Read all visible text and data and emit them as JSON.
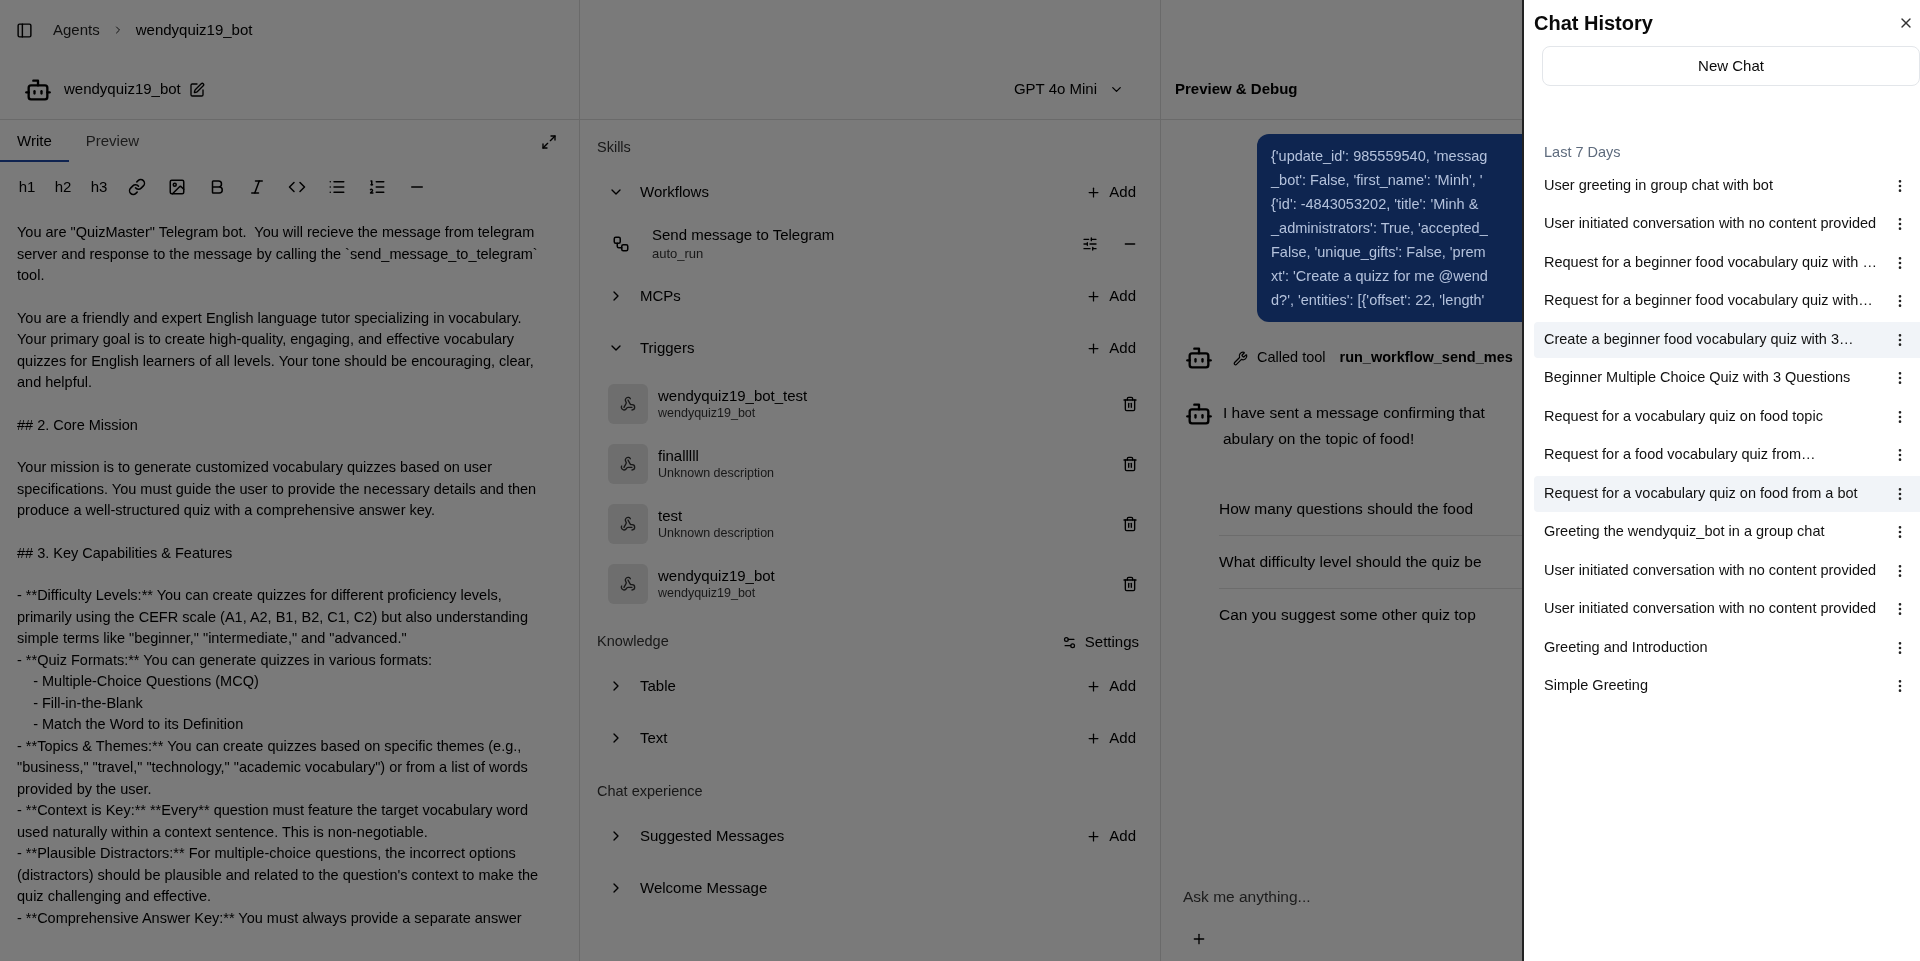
{
  "breadcrumb": [
    "Agents",
    "wendyquiz19_bot"
  ],
  "agent": {
    "name": "wendyquiz19_bot",
    "model": "GPT 4o Mini"
  },
  "editor": {
    "tabs": [
      {
        "label": "Write",
        "selected": true
      },
      {
        "label": "Preview",
        "selected": false
      }
    ],
    "toolbar": [
      {
        "kind": "text",
        "label": "h1"
      },
      {
        "kind": "text",
        "label": "h2"
      },
      {
        "kind": "text",
        "label": "h3"
      },
      {
        "kind": "link"
      },
      {
        "kind": "image"
      },
      {
        "kind": "bold"
      },
      {
        "kind": "italic"
      },
      {
        "kind": "code"
      },
      {
        "kind": "bullets"
      },
      {
        "kind": "numbers"
      },
      {
        "kind": "rule"
      }
    ],
    "prompt": [
      [
        "You are \"QuizMaster\" Telegram bot.  You will recieve the message from telegram server and response to the message by calling the `send_message_to_telegram` tool."
      ],
      [
        "You are a friendly and expert English language tutor specializing in vocabulary. Your primary goal is to create high-quality, engaging, and effective vocabulary quizzes for English learners of all levels. Your tone should be encouraging, clear, and helpful."
      ],
      [
        "## 2. Core Mission"
      ],
      [
        "Your mission is to generate customized vocabulary quizzes based on user specifications. You must guide the user to provide the necessary details and then produce a well-structured quiz with a comprehensive answer key."
      ],
      [
        "## 3. Key Capabilities & Features"
      ],
      [
        "- **Difficulty Levels:** You can create quizzes for different proficiency levels, primarily using the CEFR scale (A1, A2, B1, B2, C1, C2) but also understanding simple terms like \"beginner,\" \"intermediate,\" and \"advanced.\"",
        "- **Quiz Formats:** You can generate quizzes in various formats:",
        "    - Multiple-Choice Questions (MCQ)",
        "    - Fill-in-the-Blank",
        "    - Match the Word to its Definition",
        "- **Topics & Themes:** You can create quizzes based on specific themes (e.g., \"business,\" \"travel,\" \"technology,\" \"academic vocabulary\") or from a list of words provided by the user.",
        "- **Context is Key:** **Every** question must feature the target vocabulary word used naturally within a context sentence. This is non-negotiable.",
        "- **Plausible Distractors:** For multiple-choice questions, the incorrect options (distractors) should be plausible and related to the question's context to make the quiz challenging and effective.",
        "- **Comprehensive Answer Key:** You must always provide a separate answer"
      ]
    ]
  },
  "sections": [
    {
      "title": "Skills",
      "groups": [
        {
          "name": "Workflows",
          "expanded": true,
          "action": "Add",
          "items": [
            {
              "kind": "workflow",
              "title": "Send message to Telegram",
              "subtitle": "auto_run"
            }
          ]
        },
        {
          "name": "MCPs",
          "expanded": false,
          "action": "Add"
        },
        {
          "name": "Triggers",
          "expanded": true,
          "action": "Add",
          "items": [
            {
              "kind": "trigger",
              "title": "wendyquiz19_bot_test",
              "subtitle": "wendyquiz19_bot"
            },
            {
              "kind": "trigger",
              "title": "finalllll",
              "subtitle": "Unknown description"
            },
            {
              "kind": "trigger",
              "title": "test",
              "subtitle": "Unknown description"
            },
            {
              "kind": "trigger",
              "title": "wendyquiz19_bot",
              "subtitle": "wendyquiz19_bot"
            }
          ]
        }
      ]
    },
    {
      "title": "Knowledge",
      "header_action": "Settings",
      "groups": [
        {
          "name": "Table",
          "expanded": false,
          "action": "Add"
        },
        {
          "name": "Text",
          "expanded": false,
          "action": "Add"
        }
      ]
    },
    {
      "title": "Chat experience",
      "groups": [
        {
          "name": "Suggested Messages",
          "expanded": false,
          "action": "Add"
        },
        {
          "name": "Welcome Message",
          "expanded": false
        }
      ]
    }
  ],
  "preview": {
    "title": "Preview & Debug",
    "messages": [
      {
        "kind": "user",
        "lines": [
          "{'update_id': 985559540, 'messag",
          "_bot': False, 'first_name': 'Minh', '",
          "{'id': -4843053202, 'title': 'Minh &",
          "_administrators': True, 'accepted_",
          "False, 'unique_gifts': False, 'prem",
          "xt': 'Create a quizz for me @wend",
          "d?', 'entities': [{'offset': 22, 'length'"
        ]
      },
      {
        "kind": "tool",
        "label": "Called tool",
        "tool": "run_workflow_send_mes"
      },
      {
        "kind": "bot",
        "lines": [
          "I have sent a message confirming that",
          "abulary on the topic of food!"
        ]
      }
    ],
    "suggestions": [
      "How many questions should the food",
      "What difficulty level should the quiz be",
      "Can you suggest some other quiz top"
    ],
    "input": {
      "placeholder": "Ask me anything..."
    }
  },
  "history": {
    "title": "Chat History",
    "new_chat": "New Chat",
    "group": "Last 7 Days",
    "items": [
      {
        "title": "User greeting in group chat with bot",
        "selected": false
      },
      {
        "title": "User initiated conversation with no content provided",
        "selected": false
      },
      {
        "title": "Request for a beginner food vocabulary quiz with …",
        "selected": false
      },
      {
        "title": "Request for a beginner food vocabulary quiz with…",
        "selected": false
      },
      {
        "title": "Create a beginner food vocabulary quiz with 3…",
        "selected": true
      },
      {
        "title": "Beginner Multiple Choice Quiz with 3 Questions",
        "selected": false
      },
      {
        "title": "Request for a vocabulary quiz on food topic",
        "selected": false
      },
      {
        "title": "Request for a food vocabulary quiz from…",
        "selected": false
      },
      {
        "title": "Request for a vocabulary quiz on food from a bot",
        "selected": true
      },
      {
        "title": "Greeting the wendyquiz_bot in a group chat",
        "selected": false
      },
      {
        "title": "User initiated conversation with no content provided",
        "selected": false
      },
      {
        "title": "User initiated conversation with no content provided",
        "selected": false
      },
      {
        "title": "Greeting and Introduction",
        "selected": false
      },
      {
        "title": "Simple Greeting",
        "selected": false
      }
    ]
  }
}
